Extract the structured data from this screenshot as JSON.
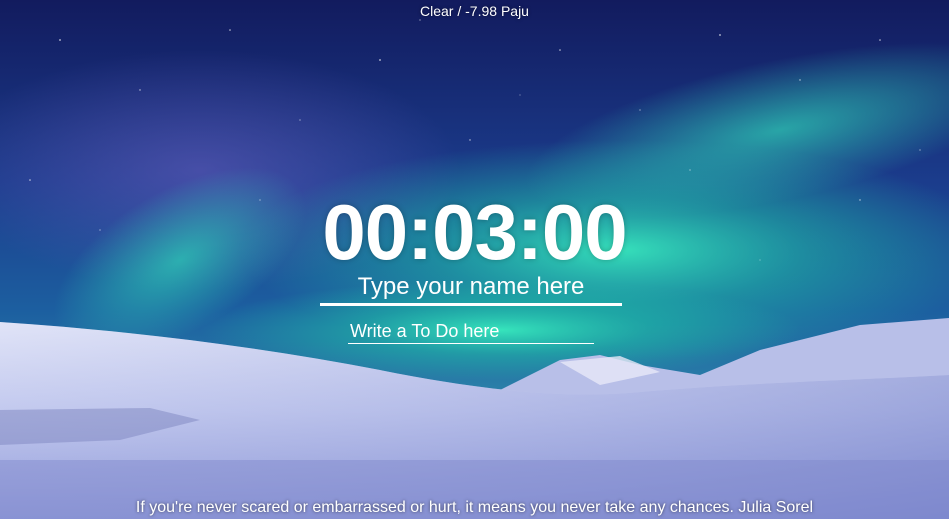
{
  "weather": {
    "text": "Clear / -7.98 Paju"
  },
  "clock": {
    "time": "00:03:00"
  },
  "name_field": {
    "placeholder": "Type your name here",
    "value": ""
  },
  "todo_field": {
    "placeholder": "Write a To Do here",
    "value": ""
  },
  "quote": {
    "text": "If you're never scared or embarrassed or hurt, it means you never take any chances. Julia Sorel"
  },
  "colors": {
    "sky_top": "#14206a",
    "sky_mid": "#1e4a9a",
    "aurora": "#2ee0b0",
    "snow": "#dfe4f6",
    "text": "#ffffff"
  }
}
